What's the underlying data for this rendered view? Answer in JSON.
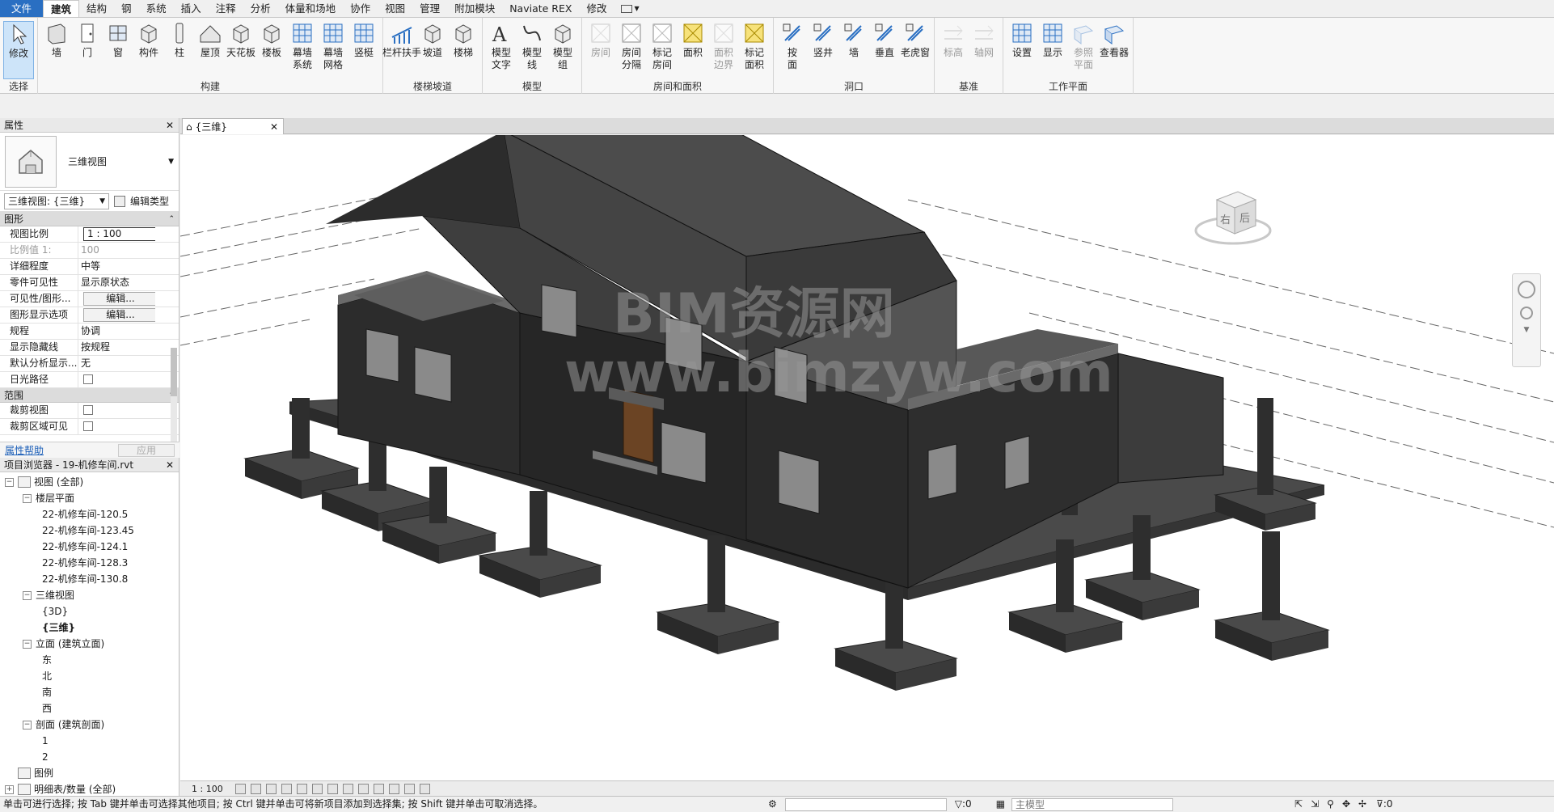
{
  "ribbon_tabs": [
    "文件",
    "建筑",
    "结构",
    "钢",
    "系统",
    "插入",
    "注释",
    "分析",
    "体量和场地",
    "协作",
    "视图",
    "管理",
    "附加模块",
    "Naviate REX",
    "修改"
  ],
  "ribbon_panels": {
    "select": {
      "title": "选择",
      "buttons": [
        "修改"
      ]
    },
    "build": {
      "title": "构建",
      "buttons": [
        "墙",
        "门",
        "窗",
        "构件",
        "柱",
        "屋顶",
        "天花板",
        "楼板",
        "幕墙\n系统",
        "幕墙\n网格",
        "竖梃"
      ]
    },
    "circulation": {
      "title": "楼梯坡道",
      "buttons": [
        "栏杆扶手",
        "坡道",
        "楼梯"
      ]
    },
    "model": {
      "title": "模型",
      "buttons": [
        "模型\n文字",
        "模型\n线",
        "模型\n组"
      ]
    },
    "room_area": {
      "title": "房间和面积",
      "buttons": [
        "房间",
        "房间\n分隔",
        "标记\n房间",
        "面积",
        "面积\n边界",
        "标记\n面积"
      ]
    },
    "opening": {
      "title": "洞口",
      "buttons": [
        "按\n面",
        "竖井",
        "墙",
        "垂直",
        "老虎窗"
      ]
    },
    "datum": {
      "title": "基准",
      "buttons": [
        "标高",
        "轴网"
      ]
    },
    "workplane": {
      "title": "工作平面",
      "buttons": [
        "设置",
        "显示",
        "参照\n平面",
        "查看器"
      ]
    }
  },
  "properties": {
    "title": "属性",
    "type_name": "三维视图",
    "selector": "三维视图: {三维}",
    "edit_type": "编辑类型",
    "groups": [
      {
        "name": "图形",
        "rows": [
          {
            "k": "视图比例",
            "v": "1 : 100",
            "kind": "input"
          },
          {
            "k": "比例值 1:",
            "v": "100",
            "kind": "dim"
          },
          {
            "k": "详细程度",
            "v": "中等",
            "kind": "text"
          },
          {
            "k": "零件可见性",
            "v": "显示原状态",
            "kind": "text"
          },
          {
            "k": "可见性/图形...",
            "v": "编辑...",
            "kind": "button"
          },
          {
            "k": "图形显示选项",
            "v": "编辑...",
            "kind": "button"
          },
          {
            "k": "规程",
            "v": "协调",
            "kind": "text"
          },
          {
            "k": "显示隐藏线",
            "v": "按规程",
            "kind": "text"
          },
          {
            "k": "默认分析显示...",
            "v": "无",
            "kind": "text"
          },
          {
            "k": "日光路径",
            "v": "",
            "kind": "check"
          }
        ]
      },
      {
        "name": "范围",
        "rows": [
          {
            "k": "裁剪视图",
            "v": "",
            "kind": "check"
          },
          {
            "k": "裁剪区域可见",
            "v": "",
            "kind": "check"
          }
        ]
      }
    ],
    "help_link": "属性帮助",
    "apply": "应用"
  },
  "browser": {
    "title": "项目浏览器 - 19-机修车间.rvt",
    "items": [
      {
        "level": 0,
        "text": "视图 (全部)",
        "toggle": "−",
        "icon": true
      },
      {
        "level": 1,
        "text": "楼层平面",
        "toggle": "−"
      },
      {
        "level": 2,
        "text": "22-机修车间-120.5"
      },
      {
        "level": 2,
        "text": "22-机修车间-123.45"
      },
      {
        "level": 2,
        "text": "22-机修车间-124.1"
      },
      {
        "level": 2,
        "text": "22-机修车间-128.3"
      },
      {
        "level": 2,
        "text": "22-机修车间-130.8"
      },
      {
        "level": 1,
        "text": "三维视图",
        "toggle": "−"
      },
      {
        "level": 2,
        "text": "{3D}"
      },
      {
        "level": 2,
        "text": "{三维}",
        "bold": true
      },
      {
        "level": 1,
        "text": "立面 (建筑立面)",
        "toggle": "−"
      },
      {
        "level": 2,
        "text": "东"
      },
      {
        "level": 2,
        "text": "北"
      },
      {
        "level": 2,
        "text": "南"
      },
      {
        "level": 2,
        "text": "西"
      },
      {
        "level": 1,
        "text": "剖面 (建筑剖面)",
        "toggle": "−"
      },
      {
        "level": 2,
        "text": "1"
      },
      {
        "level": 2,
        "text": "2"
      },
      {
        "level": 0,
        "text": "图例",
        "toggle": "",
        "icon": true
      },
      {
        "level": 0,
        "text": "明细表/数量 (全部)",
        "toggle": "+",
        "icon": true
      }
    ]
  },
  "view_tab": "{三维}",
  "viewcube": {
    "left": "右",
    "front": "后"
  },
  "watermark": {
    "line1": "BIM资源网",
    "line2": "www.bimzyw.com"
  },
  "view_scale": "1 : 100",
  "status": {
    "message": "单击可进行选择; 按 Tab 键并单击可选择其他项目; 按 Ctrl 键并单击可将新项目添加到选择集; 按 Shift 键并单击可取消选择。",
    "selection_count": ":0",
    "filter_count": ":0",
    "model": "主模型"
  },
  "colors": {
    "accent": "#2a6fc2",
    "selected": "#cde4f9",
    "wall": "#2a2a2a",
    "roof": "#4a4a4a",
    "door": "#6b4424"
  }
}
